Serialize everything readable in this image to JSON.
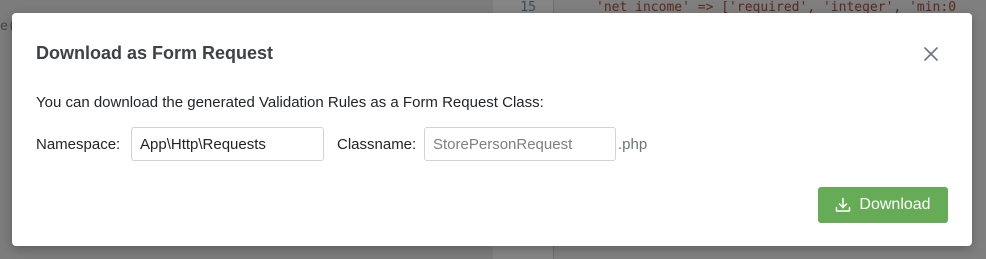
{
  "background": {
    "editor_line_number": "15",
    "editor_code": "'net income' => ['required', 'integer', 'min:0",
    "left_fragment": "e("
  },
  "modal": {
    "title": "Download as Form Request",
    "description": "You can download the generated Validation Rules as a Form Request Class:",
    "namespace": {
      "label": "Namespace:",
      "value": "App\\Http\\Requests"
    },
    "classname": {
      "label": "Classname:",
      "placeholder": "StorePersonRequest",
      "suffix": ".php"
    },
    "download_button": {
      "label": "Download",
      "icon": "download-icon",
      "color": "#66ac57"
    },
    "close_icon": "close-icon"
  }
}
